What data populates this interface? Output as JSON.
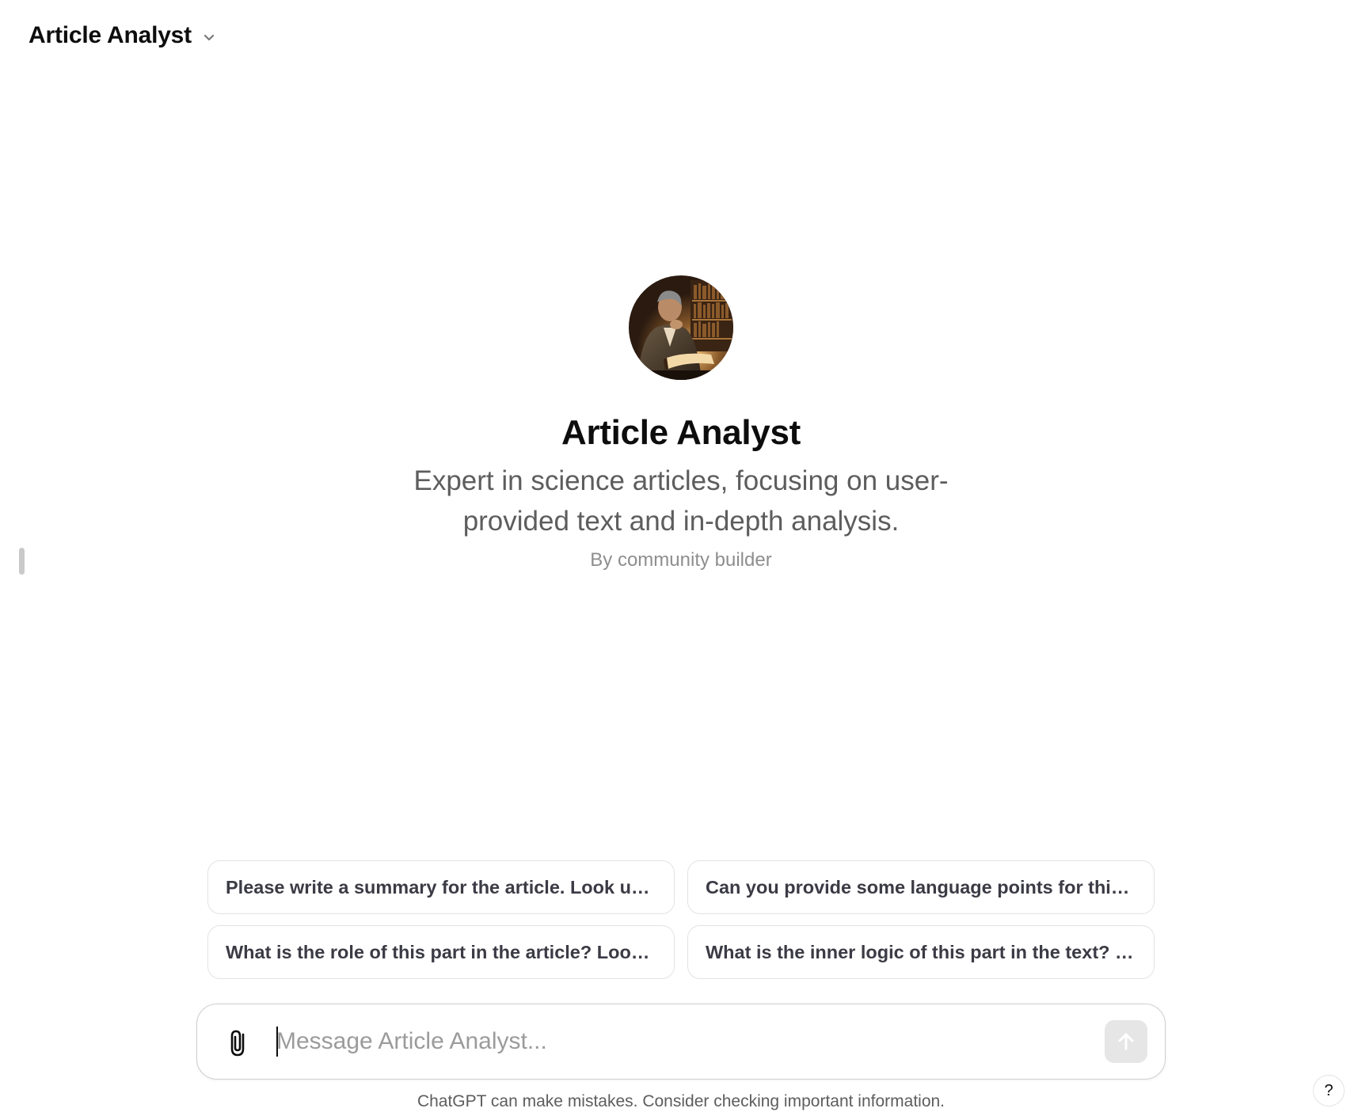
{
  "header": {
    "title": "Article Analyst",
    "dropdown_icon": "chevron-down-icon"
  },
  "gpt": {
    "name": "Article Analyst",
    "description": "Expert in science articles, focusing on user-provided text and in-depth analysis.",
    "author": "By community builder",
    "avatar_icon": "avatar-scholar-reading-icon"
  },
  "suggestions": [
    "Please write a summary for the article. Look up...",
    "Can you provide some language points for this...",
    "What is the role of this part in the article? Look ...",
    "What is the inner logic of this part in the text? L..."
  ],
  "composer": {
    "placeholder": "Message Article Analyst...",
    "value": "",
    "attach_icon": "paperclip-icon",
    "send_icon": "arrow-up-icon"
  },
  "footer": {
    "disclaimer": "ChatGPT can make mistakes. Consider checking important information."
  },
  "help": {
    "label": "?"
  },
  "colors": {
    "title": "#0d0d0d",
    "description": "#5d5d5d",
    "author": "#8e8e8e",
    "suggestion_text": "#3b3b45",
    "border": "#e3e3e3",
    "send_disabled_bg": "#e6e6e6"
  }
}
